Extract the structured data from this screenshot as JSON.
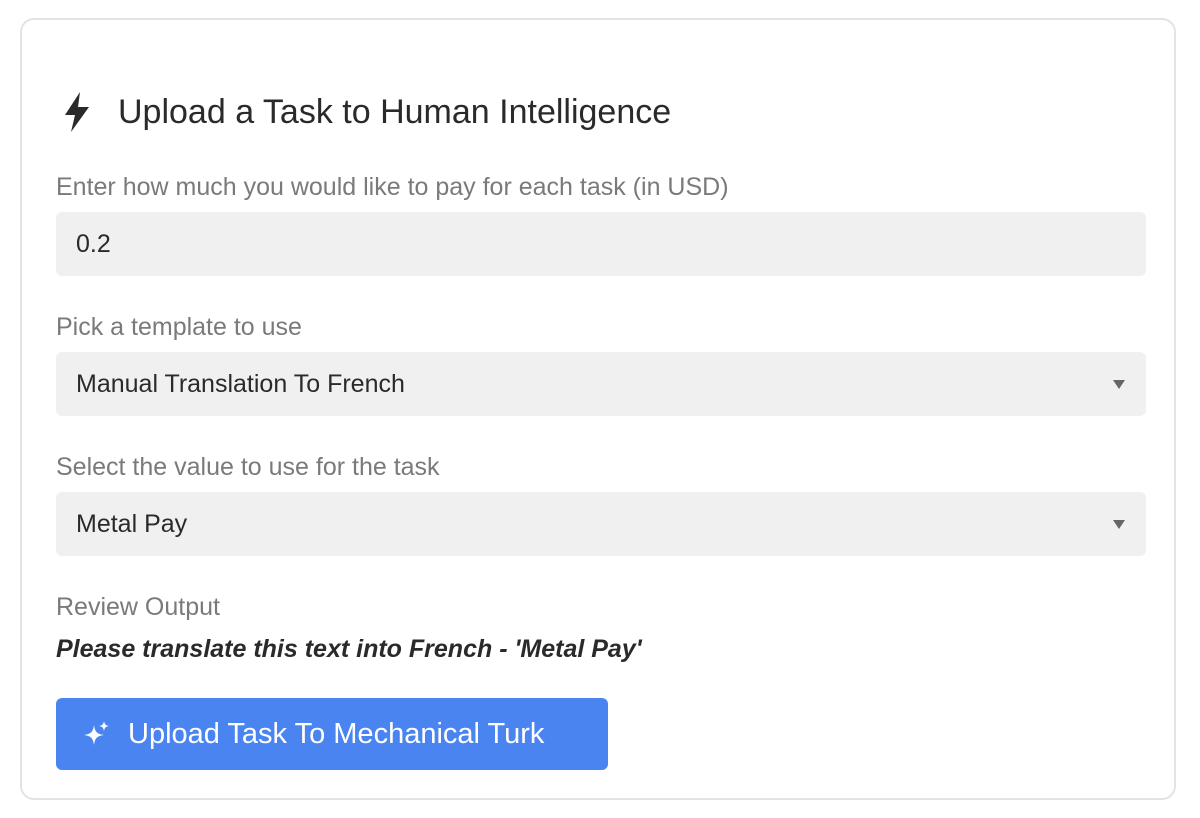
{
  "card": {
    "title": "Upload a Task to Human Intelligence",
    "title_icon": "lightning-bolt-icon"
  },
  "payment": {
    "label": "Enter how much you would like to pay for each task (in USD)",
    "value": "0.2"
  },
  "template": {
    "label": "Pick a template to use",
    "selected": "Manual Translation To French",
    "icon": "chevron-down-icon"
  },
  "task_value": {
    "label": "Select the value to use for the task",
    "selected": "Metal Pay",
    "icon": "chevron-down-icon"
  },
  "review": {
    "label": "Review Output",
    "output": "Please translate this text into French - 'Metal Pay'"
  },
  "upload_button": {
    "label": "Upload Task To Mechanical Turk",
    "icon": "sparkles-icon",
    "color": "#4a84f0"
  }
}
